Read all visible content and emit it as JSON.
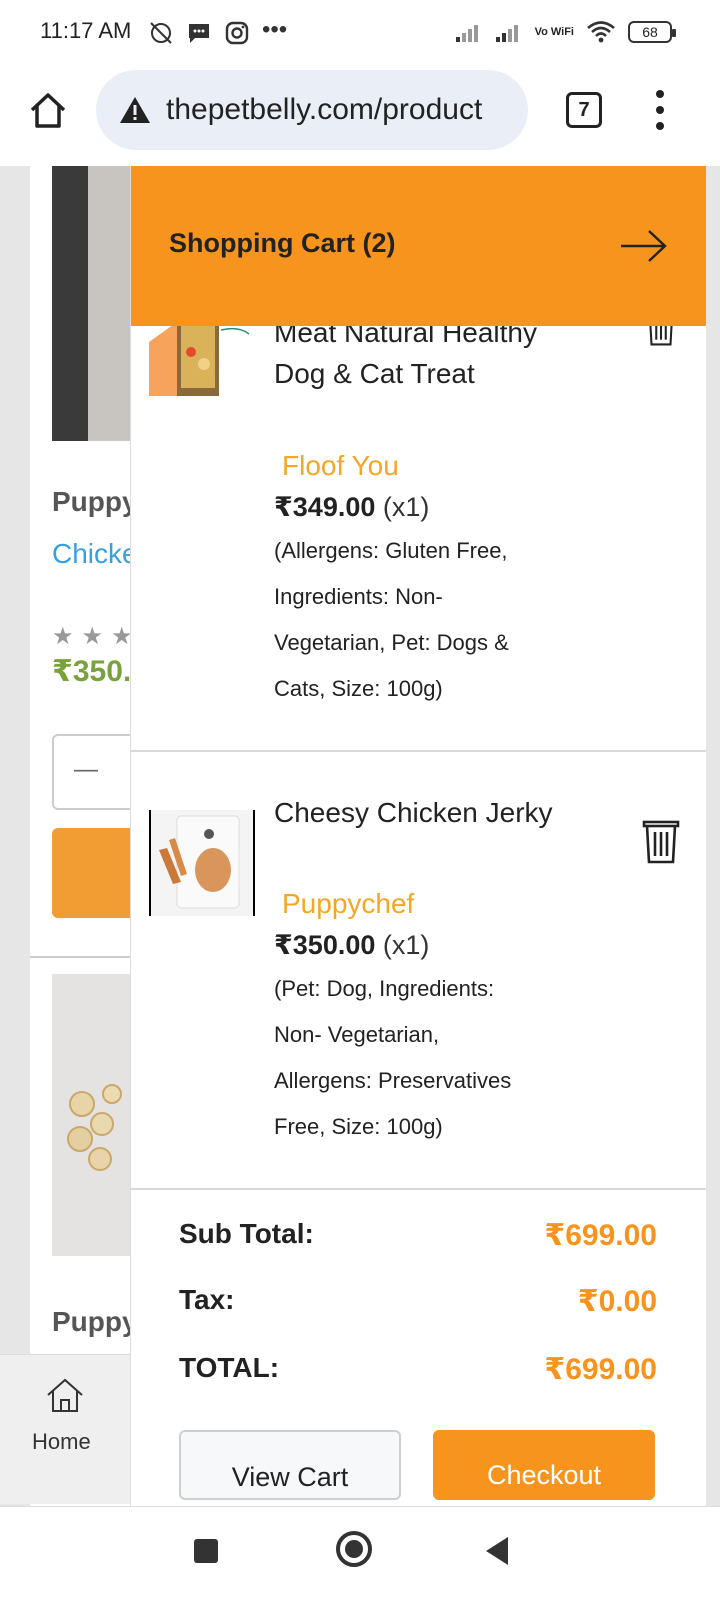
{
  "status_bar": {
    "time": "11:17 AM",
    "battery": "68",
    "vowifi": "Vo WiFi",
    "icons": [
      "alarm-off-icon",
      "message-icon",
      "instagram-icon",
      "more-dots-icon",
      "signal-icon",
      "signal-icon",
      "vowifi-icon",
      "wifi-icon",
      "battery-icon"
    ]
  },
  "browser": {
    "url": "thepetbelly.com/product",
    "tab_count": "7"
  },
  "background_page": {
    "product1_title": "Puppy",
    "product1_subtitle": "Chicke",
    "product1_stars": "★★★",
    "product1_price": "₹350.",
    "qty_minus": "—",
    "product2_title": "Puppy",
    "bottom_nav_home": "Home"
  },
  "cart": {
    "title": "Shopping Cart (2)",
    "items": [
      {
        "name": "Meat Natural Healthy Dog & Cat Treat",
        "brand": "Floof You",
        "price": "₹349.00",
        "qty": "(x1)",
        "attrs": "(Allergens: Gluten Free, Ingredients: Non-Vegetarian, Pet: Dogs & Cats, Size: 100g)"
      },
      {
        "name": "Cheesy Chicken Jerky",
        "brand": "Puppychef",
        "price": "₹350.00",
        "qty": "(x1)",
        "attrs": "(Pet: Dog, Ingredients: Non- Vegetarian, Allergens: Preservatives Free, Size: 100g)"
      }
    ],
    "subtotal_label": "Sub Total:",
    "subtotal_value": "₹699.00",
    "tax_label": "Tax:",
    "tax_value": "₹0.00",
    "total_label": "TOTAL:",
    "total_value": "₹699.00",
    "view_cart_label": "View Cart",
    "checkout_label": "Checkout"
  },
  "colors": {
    "accent": "#f7941d",
    "brand_text": "#f5a623"
  }
}
